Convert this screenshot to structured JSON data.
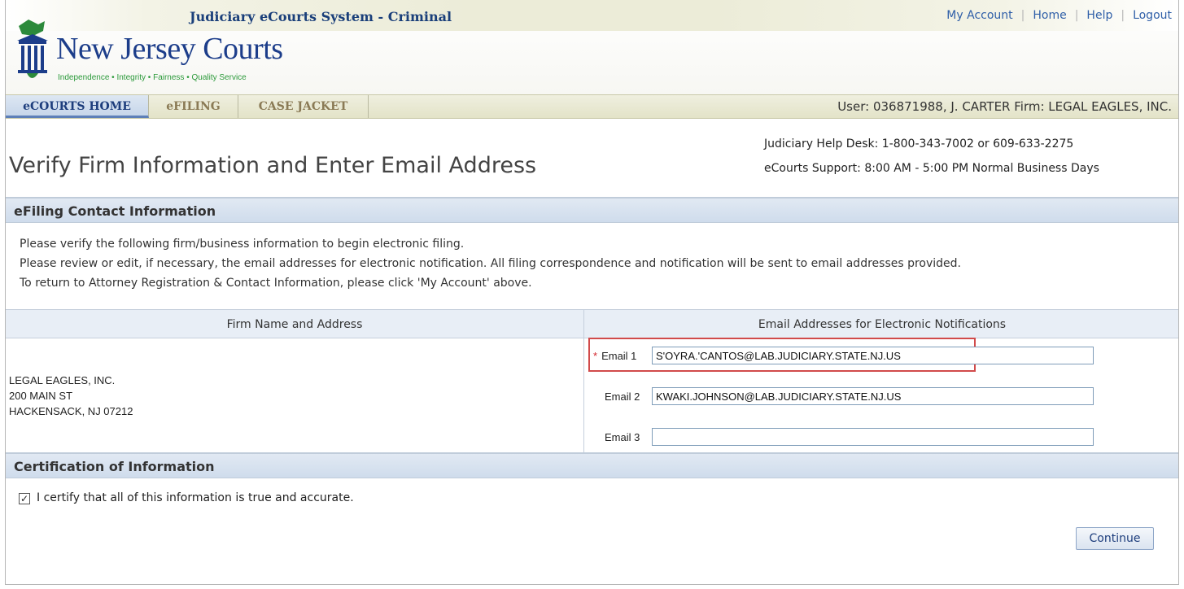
{
  "header": {
    "system_title": "Judiciary eCourts System - Criminal",
    "links": [
      "My Account",
      "Home",
      "Help",
      "Logout"
    ],
    "logo_name": "New Jersey Courts",
    "logo_tagline": "Independence • Integrity • Fairness • Quality Service"
  },
  "nav": {
    "tabs": [
      {
        "label": "eCOURTS HOME",
        "active": true
      },
      {
        "label": "eFILING",
        "active": false
      },
      {
        "label": "CASE JACKET",
        "active": false
      }
    ],
    "user_info": "User: 036871988, J. CARTER  Firm: LEGAL EAGLES, INC."
  },
  "page": {
    "title": "Verify Firm Information and Enter Email Address",
    "helpdesk_line1": "Judiciary Help Desk: 1-800-343-7002 or 609-633-2275",
    "helpdesk_line2": "eCourts Support: 8:00 AM - 5:00 PM Normal Business Days"
  },
  "contact_section": {
    "title": "eFiling Contact Information",
    "instructions": [
      "Please verify the following firm/business information to begin electronic filing.",
      "Please review or edit, if necessary, the email addresses for electronic notification. All filing correspondence and notification will be sent to email addresses provided.",
      "To return to Attorney Registration & Contact Information, please click 'My Account' above."
    ],
    "col_firm_header": "Firm Name and Address",
    "col_email_header": "Email Addresses for Electronic Notifications",
    "firm_address_lines": [
      "LEGAL EAGLES, INC.",
      "200 MAIN ST",
      "HACKENSACK, NJ 07212"
    ],
    "emails": [
      {
        "label": "Email 1",
        "value": "S'OYRA.'CANTOS@LAB.JUDICIARY.STATE.NJ.US",
        "required": true
      },
      {
        "label": "Email 2",
        "value": "KWAKI.JOHNSON@LAB.JUDICIARY.STATE.NJ.US",
        "required": false
      },
      {
        "label": "Email 3",
        "value": "",
        "required": false
      }
    ],
    "required_mark": "*"
  },
  "certification": {
    "title": "Certification of Information",
    "checkbox_label": "I certify that all of this information is true and accurate.",
    "checked": true,
    "check_glyph": "✓"
  },
  "actions": {
    "continue_label": "Continue"
  },
  "colors": {
    "link_blue": "#2f5fa8",
    "highlight_red": "#d14a4a",
    "section_bar": "#cfdcec"
  }
}
